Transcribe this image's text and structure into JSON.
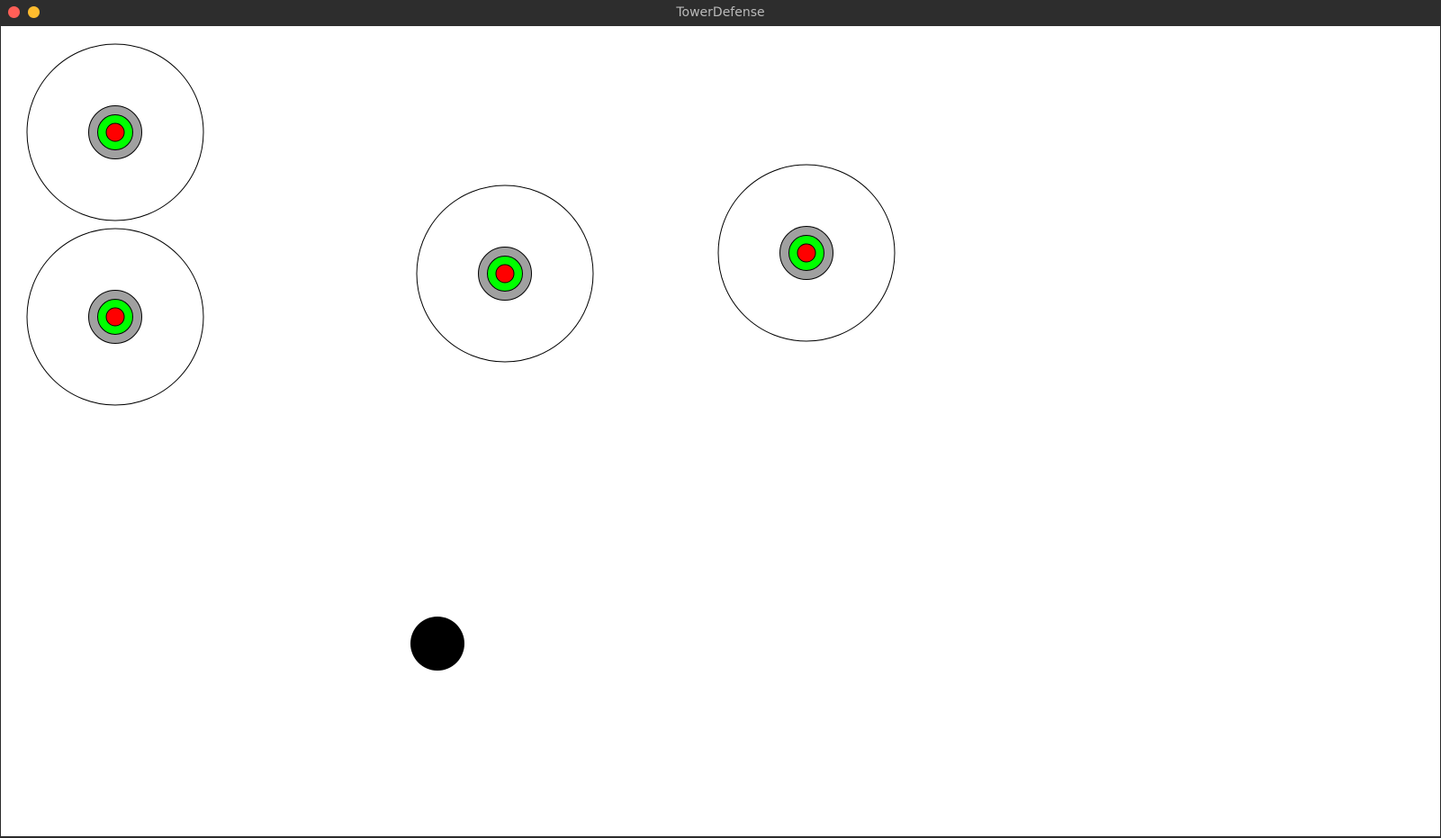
{
  "window": {
    "title": "TowerDefense",
    "colors": {
      "titlebar_text": "#b9b9b9",
      "close": "#ff5f57",
      "minimize": "#febc2e",
      "canvas_bg": "#ffffff"
    },
    "icons": {
      "close": "close-dot-icon",
      "minimize": "minimize-dot-icon"
    }
  },
  "game": {
    "colors": {
      "tower_base": "#a0a0a0",
      "tower_ring": "#00ff00",
      "tower_core": "#ff0000",
      "range_stroke": "#000000",
      "enemy": "#000000"
    },
    "tower_count": 4,
    "enemy_count": 1
  }
}
